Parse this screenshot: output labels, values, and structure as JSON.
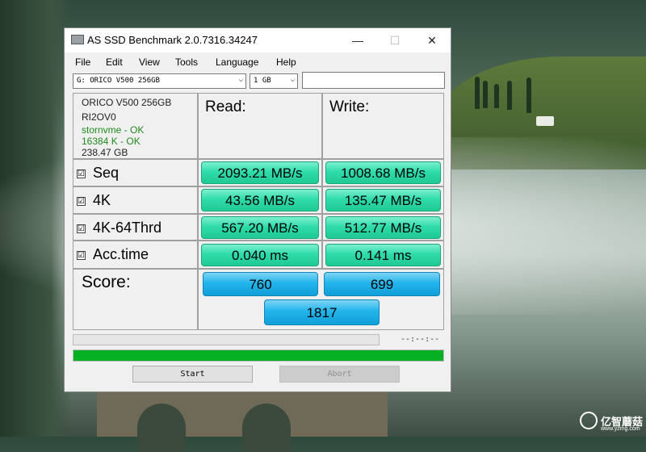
{
  "window": {
    "title": "AS SSD Benchmark 2.0.7316.34247",
    "controls": {
      "minimize": "—",
      "maximize": "☐",
      "close": "✕"
    }
  },
  "menu": [
    "File",
    "Edit",
    "View",
    "Tools",
    "Language",
    "Help"
  ],
  "toolbar": {
    "drive_select": "G: ORICO V500 256GB",
    "size_select": "1 GB",
    "text_field": ""
  },
  "drive_info": {
    "model": "ORICO V500 256GB",
    "firmware": "RI2OV0",
    "driver": "stornvme - OK",
    "alignment": "16384 K - OK",
    "capacity": "238.47 GB"
  },
  "headers": {
    "read": "Read:",
    "write": "Write:"
  },
  "rows": [
    {
      "label": "Seq",
      "checked": "☑",
      "read": "2093.21 MB/s",
      "write": "1008.68 MB/s"
    },
    {
      "label": "4K",
      "checked": "☑",
      "read": "43.56 MB/s",
      "write": "135.47 MB/s"
    },
    {
      "label": "4K-64Thrd",
      "checked": "☑",
      "read": "567.20 MB/s",
      "write": "512.77 MB/s"
    },
    {
      "label": "Acc.time",
      "checked": "☑",
      "read": "0.040 ms",
      "write": "0.141 ms"
    }
  ],
  "score": {
    "label": "Score:",
    "read": "760",
    "write": "699",
    "total": "1817"
  },
  "progress": {
    "elapsed": "--:--:--",
    "total_fill": 1.0,
    "top_fill": 0.0
  },
  "buttons": {
    "start": "Start",
    "abort": "Abort"
  },
  "watermark": {
    "text": "亿智蘑菇",
    "sub": "www.yzmg.com"
  },
  "colors": {
    "result_green": "#2fdcaa",
    "score_blue": "#22b5ea",
    "progress_green": "#06b025",
    "ok_text": "#1f8a1f"
  }
}
